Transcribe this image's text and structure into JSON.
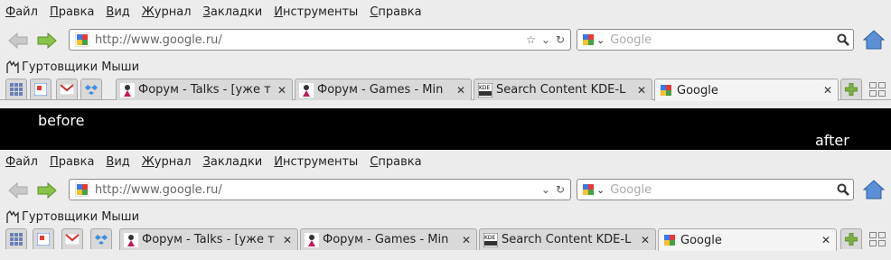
{
  "labels": {
    "before": "before",
    "after": "after"
  },
  "menu": [
    "Файл",
    "Правка",
    "Вид",
    "Журнал",
    "Закладки",
    "Инструменты",
    "Справка"
  ],
  "url": "http://www.google.ru/",
  "search_placeholder": "Google",
  "bookmark": "Гуртовщики Мыши",
  "tabs": [
    {
      "title": "Форум - Talks - [уже т",
      "icon": "forum-favicon-icon"
    },
    {
      "title": "Форум - Games - Min",
      "icon": "forum-favicon-icon"
    },
    {
      "title": "Search Content KDE-L",
      "icon": "kde-favicon-icon"
    },
    {
      "title": "Google",
      "icon": "google-favicon-icon"
    }
  ],
  "colors": {
    "nav_arrow": "#7fbf3f",
    "home": "#4a7fc8",
    "divider": "#000000"
  }
}
